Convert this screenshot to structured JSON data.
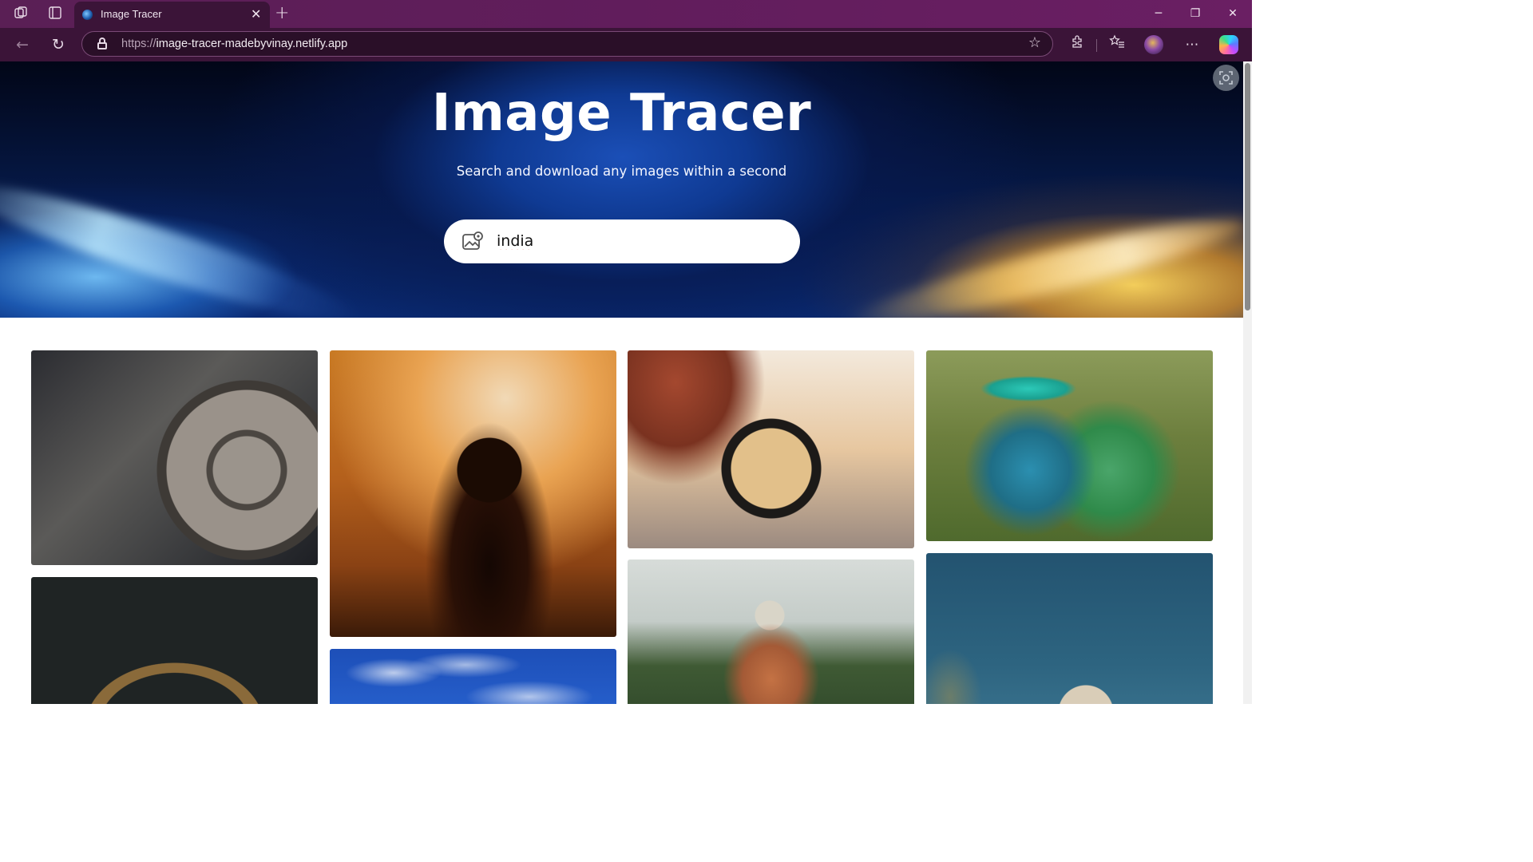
{
  "browser": {
    "tab_title": "Image Tracer",
    "url_protocol": "https://",
    "url_host": "image-tracer-madebyvinay.netlify.app"
  },
  "page": {
    "title": "Image Tracer",
    "subtitle": "Search and download any images within a second",
    "search": {
      "value": "india"
    }
  },
  "icons": {
    "search": "image-icon",
    "tab_actions": "workspaces-icon",
    "tab_list": "tab-actions-icon",
    "favorites": "favorites-icon",
    "extensions": "extensions-icon"
  },
  "colors": {
    "titlebar": "#611d5c",
    "toolbar": "#3b1438",
    "hero_accent": "#0f3a93"
  }
}
